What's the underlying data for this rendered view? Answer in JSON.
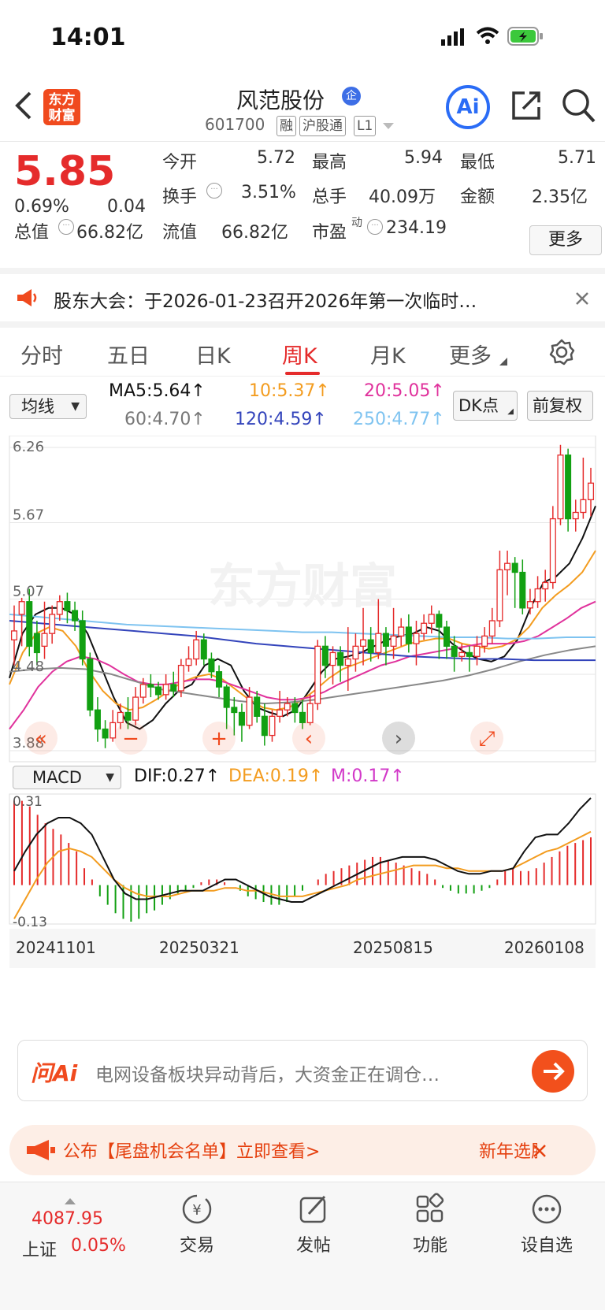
{
  "status": {
    "time": "14:01"
  },
  "header": {
    "logo_text": "东方财富",
    "title": "风范股份",
    "code": "601700",
    "tags": [
      "融",
      "沪股通",
      "L1"
    ],
    "ai_label": "Ai"
  },
  "quote": {
    "price": "5.85",
    "change_pct": "0.69%",
    "change": "0.04",
    "open_label": "今开",
    "open": "5.72",
    "high_label": "最高",
    "high": "5.94",
    "low_label": "最低",
    "low": "5.71",
    "turnover_label": "换手",
    "turnover": "3.51%",
    "volume_label": "总手",
    "volume": "40.09万",
    "amount_label": "金额",
    "amount": "2.35亿",
    "mcap_label": "总值",
    "mcap": "66.82亿",
    "float_label": "流值",
    "float": "66.82亿",
    "pe_label": "市盈",
    "pe_sup": "动",
    "pe": "234.19",
    "more": "更多"
  },
  "notice": {
    "text": "股东大会：于2026-01-23召开2026年第一次临时…"
  },
  "tabs": [
    "分时",
    "五日",
    "日K",
    "周K",
    "月K",
    "更多"
  ],
  "active_tab": "周K",
  "ma": {
    "selector": "均线",
    "ma5": "MA5:5.64↑",
    "ma10": "10:5.37↑",
    "ma20": "20:5.05↑",
    "ma60": "60:4.70↑",
    "ma120": "120:4.59↑",
    "ma250": "250:4.77↑",
    "dk": "DK点",
    "fq": "前复权",
    "colors": {
      "ma5": "#111111",
      "ma10": "#f39c1f",
      "ma20": "#e0329c",
      "ma60": "#888888",
      "ma120": "#3344bb",
      "ma250": "#7ec3f0"
    }
  },
  "macd": {
    "selector": "MACD",
    "dif": "DIF:0.27↑",
    "dea": "DEA:0.19↑",
    "m": "M:0.17↑",
    "ytop": "0.31",
    "ybot": "-0.13"
  },
  "chart_data": {
    "type": "candlestick",
    "y_ticks": [
      "6.26",
      "5.67",
      "5.07",
      "4.48",
      "3.88"
    ],
    "ylim": [
      3.88,
      6.26
    ],
    "x_labels": [
      "20241101",
      "20250321",
      "20250815",
      "20260108"
    ],
    "watermark": "东方财富",
    "candles": [
      [
        4.75,
        4.82,
        4.55,
        5.02
      ],
      [
        4.95,
        5.05,
        4.7,
        5.08
      ],
      [
        5.05,
        4.7,
        4.62,
        5.15
      ],
      [
        4.8,
        4.65,
        4.55,
        4.9
      ],
      [
        4.7,
        4.8,
        4.6,
        5.05
      ],
      [
        4.8,
        4.95,
        4.72,
        5.02
      ],
      [
        4.95,
        5.05,
        4.9,
        5.1
      ],
      [
        5.05,
        4.98,
        4.88,
        5.12
      ],
      [
        4.98,
        4.9,
        4.82,
        5.05
      ],
      [
        4.9,
        4.6,
        4.55,
        4.98
      ],
      [
        4.6,
        4.2,
        4.15,
        4.65
      ],
      [
        4.2,
        4.05,
        3.95,
        4.3
      ],
      [
        4.05,
        3.98,
        3.9,
        4.12
      ],
      [
        3.98,
        4.1,
        3.95,
        4.2
      ],
      [
        4.1,
        4.18,
        4.05,
        4.25
      ],
      [
        4.18,
        4.12,
        4.05,
        4.3
      ],
      [
        4.12,
        4.3,
        4.08,
        4.38
      ],
      [
        4.3,
        4.4,
        4.25,
        4.45
      ],
      [
        4.4,
        4.38,
        4.3,
        4.48
      ],
      [
        4.38,
        4.32,
        4.28,
        4.42
      ],
      [
        4.32,
        4.4,
        4.28,
        4.48
      ],
      [
        4.4,
        4.35,
        4.3,
        4.5
      ],
      [
        4.35,
        4.55,
        4.3,
        4.6
      ],
      [
        4.55,
        4.6,
        4.5,
        4.7
      ],
      [
        4.6,
        4.75,
        4.55,
        4.82
      ],
      [
        4.75,
        4.6,
        4.55,
        4.8
      ],
      [
        4.6,
        4.5,
        4.45,
        4.65
      ],
      [
        4.5,
        4.38,
        4.3,
        4.55
      ],
      [
        4.38,
        4.22,
        4.05,
        4.4
      ],
      [
        4.22,
        4.18,
        4.0,
        4.3
      ],
      [
        4.18,
        4.08,
        3.95,
        4.25
      ],
      [
        4.08,
        4.3,
        4.05,
        4.38
      ],
      [
        4.3,
        4.15,
        4.1,
        4.35
      ],
      [
        4.15,
        4.0,
        3.92,
        4.25
      ],
      [
        4.0,
        4.15,
        3.95,
        4.2
      ],
      [
        4.15,
        4.2,
        4.1,
        4.35
      ],
      [
        4.2,
        4.25,
        4.15,
        4.3
      ],
      [
        4.25,
        4.18,
        4.1,
        4.3
      ],
      [
        4.18,
        4.1,
        4.05,
        4.28
      ],
      [
        4.1,
        4.25,
        4.08,
        4.32
      ],
      [
        4.25,
        4.7,
        4.2,
        4.75
      ],
      [
        4.7,
        4.55,
        4.45,
        4.78
      ],
      [
        4.55,
        4.65,
        4.4,
        4.7
      ],
      [
        4.65,
        4.55,
        4.42,
        4.7
      ],
      [
        4.55,
        4.6,
        4.35,
        4.85
      ],
      [
        4.6,
        4.7,
        4.5,
        4.8
      ],
      [
        4.7,
        4.75,
        4.55,
        5.0
      ],
      [
        4.75,
        4.65,
        4.58,
        4.85
      ],
      [
        4.65,
        4.8,
        4.6,
        5.07
      ],
      [
        4.8,
        4.7,
        4.55,
        4.85
      ],
      [
        4.7,
        4.78,
        4.6,
        5.0
      ],
      [
        4.78,
        4.85,
        4.7,
        4.92
      ],
      [
        4.85,
        4.72,
        4.65,
        4.95
      ],
      [
        4.72,
        4.8,
        4.55,
        4.9
      ],
      [
        4.8,
        4.88,
        4.75,
        4.95
      ],
      [
        4.88,
        4.95,
        4.8,
        5.02
      ],
      [
        4.95,
        4.85,
        4.6,
        4.98
      ],
      [
        4.85,
        4.7,
        4.6,
        4.9
      ],
      [
        4.7,
        4.62,
        4.5,
        4.78
      ],
      [
        4.62,
        4.65,
        4.58,
        4.72
      ],
      [
        4.65,
        4.62,
        4.5,
        4.7
      ],
      [
        4.62,
        4.7,
        4.55,
        4.78
      ],
      [
        4.7,
        4.78,
        4.65,
        4.85
      ],
      [
        4.78,
        4.9,
        4.72,
        5.0
      ],
      [
        4.9,
        5.3,
        4.85,
        5.45
      ],
      [
        5.3,
        5.35,
        5.1,
        5.45
      ],
      [
        5.35,
        5.28,
        5.0,
        5.4
      ],
      [
        5.28,
        5.0,
        4.95,
        5.38
      ],
      [
        5.0,
        5.05,
        4.95,
        5.15
      ],
      [
        5.05,
        5.15,
        5.0,
        5.25
      ],
      [
        5.15,
        5.2,
        5.05,
        5.3
      ],
      [
        5.2,
        5.7,
        5.15,
        5.8
      ],
      [
        5.7,
        6.2,
        5.65,
        6.28
      ],
      [
        6.2,
        5.7,
        5.6,
        6.25
      ],
      [
        5.7,
        5.75,
        5.6,
        5.85
      ],
      [
        5.75,
        5.85,
        5.7,
        6.18
      ],
      [
        5.85,
        5.98,
        5.72,
        6.1
      ]
    ],
    "ma_series_values": {
      "ma5": [
        4.45,
        4.8,
        4.95,
        5.0,
        5.0,
        4.95,
        4.8,
        4.55,
        4.3,
        4.1,
        4.05,
        4.12,
        4.25,
        4.35,
        4.4,
        4.55,
        4.6,
        4.55,
        4.35,
        4.22,
        4.18,
        4.15,
        4.2,
        4.35,
        4.5,
        4.6,
        4.62,
        4.65,
        4.7,
        4.75,
        4.78,
        4.8,
        4.85,
        4.82,
        4.72,
        4.65,
        4.6,
        4.58,
        4.62,
        4.75,
        5.0,
        5.2,
        5.25,
        5.35,
        5.55,
        5.8
      ],
      "ma10": [
        4.4,
        4.65,
        4.8,
        4.85,
        4.82,
        4.7,
        4.5,
        4.35,
        4.25,
        4.2,
        4.22,
        4.28,
        4.35,
        4.42,
        4.46,
        4.48,
        4.44,
        4.36,
        4.28,
        4.22,
        4.2,
        4.22,
        4.28,
        4.36,
        4.45,
        4.52,
        4.56,
        4.6,
        4.64,
        4.68,
        4.72,
        4.74,
        4.76,
        4.76,
        4.72,
        4.7,
        4.68,
        4.7,
        4.75,
        4.85,
        5.0,
        5.1,
        5.18,
        5.28,
        5.45
      ],
      "ma20": [
        4.05,
        4.2,
        4.38,
        4.5,
        4.58,
        4.62,
        4.6,
        4.55,
        4.48,
        4.42,
        4.4,
        4.4,
        4.42,
        4.44,
        4.44,
        4.42,
        4.38,
        4.34,
        4.3,
        4.28,
        4.28,
        4.3,
        4.34,
        4.4,
        4.45,
        4.5,
        4.55,
        4.58,
        4.62,
        4.64,
        4.66,
        4.68,
        4.7,
        4.72,
        4.72,
        4.72,
        4.74,
        4.78,
        4.85,
        4.92,
        5.0,
        5.05
      ],
      "ma60": [
        4.5,
        4.52,
        4.53,
        4.52,
        4.48,
        4.42,
        4.36,
        4.33,
        4.3,
        4.27,
        4.25,
        4.26,
        4.28,
        4.31,
        4.34,
        4.37,
        4.4,
        4.43,
        4.47,
        4.52,
        4.58,
        4.63,
        4.67,
        4.7
      ],
      "ma120": [
        4.9,
        4.88,
        4.86,
        4.84,
        4.82,
        4.8,
        4.78,
        4.75,
        4.72,
        4.7,
        4.68,
        4.66,
        4.64,
        4.62,
        4.61,
        4.6,
        4.6,
        4.59,
        4.59,
        4.59
      ],
      "ma250": [
        4.95,
        4.93,
        4.91,
        4.89,
        4.87,
        4.86,
        4.85,
        4.84,
        4.83,
        4.82,
        4.81,
        4.81,
        4.8,
        4.79,
        4.78,
        4.77,
        4.77,
        4.76,
        4.76,
        4.77,
        4.77
      ]
    },
    "macd_hist": [
      0.3,
      0.3,
      0.28,
      0.25,
      0.22,
      0.2,
      0.18,
      0.15,
      0.12,
      0.06,
      0.02,
      -0.04,
      -0.07,
      -0.1,
      -0.12,
      -0.13,
      -0.12,
      -0.1,
      -0.09,
      -0.07,
      -0.05,
      -0.03,
      -0.02,
      -0.01,
      0.01,
      0.02,
      0.02,
      0.01,
      0.0,
      -0.02,
      -0.04,
      -0.05,
      -0.06,
      -0.07,
      -0.07,
      -0.06,
      -0.04,
      -0.02,
      0.0,
      0.02,
      0.04,
      0.05,
      0.06,
      0.07,
      0.08,
      0.09,
      0.1,
      0.1,
      0.09,
      0.08,
      0.07,
      0.06,
      0.05,
      0.04,
      0.02,
      -0.01,
      -0.02,
      -0.03,
      -0.03,
      -0.03,
      -0.02,
      -0.01,
      0.02,
      0.05,
      0.06,
      0.05,
      0.05,
      0.06,
      0.08,
      0.1,
      0.12,
      0.14,
      0.15,
      0.16,
      0.17
    ],
    "dif": [
      0.05,
      0.12,
      0.18,
      0.22,
      0.24,
      0.24,
      0.22,
      0.18,
      0.1,
      0.02,
      -0.03,
      -0.05,
      -0.05,
      -0.04,
      -0.03,
      -0.02,
      -0.02,
      -0.02,
      0.0,
      0.02,
      0.02,
      0.0,
      -0.02,
      -0.04,
      -0.05,
      -0.06,
      -0.06,
      -0.04,
      -0.02,
      0.0,
      0.02,
      0.04,
      0.06,
      0.08,
      0.09,
      0.1,
      0.1,
      0.1,
      0.09,
      0.07,
      0.05,
      0.04,
      0.04,
      0.05,
      0.05,
      0.06,
      0.12,
      0.17,
      0.18,
      0.18,
      0.22,
      0.27,
      0.31
    ],
    "dea": [
      -0.12,
      -0.05,
      0.02,
      0.08,
      0.12,
      0.13,
      0.12,
      0.1,
      0.06,
      0.02,
      -0.01,
      -0.03,
      -0.04,
      -0.04,
      -0.04,
      -0.03,
      -0.02,
      -0.02,
      -0.02,
      -0.01,
      -0.01,
      -0.02,
      -0.02,
      -0.03,
      -0.04,
      -0.04,
      -0.04,
      -0.03,
      -0.02,
      -0.01,
      0.0,
      0.02,
      0.03,
      0.04,
      0.05,
      0.06,
      0.07,
      0.07,
      0.07,
      0.06,
      0.06,
      0.05,
      0.05,
      0.05,
      0.05,
      0.06,
      0.08,
      0.1,
      0.12,
      0.13,
      0.15,
      0.17,
      0.19
    ]
  },
  "ai_bar": {
    "logo": "问Ai",
    "text": "电网设备板块异动背后，大资金正在调仓…"
  },
  "promo": {
    "text": "公布【尾盘机会名单】立即查看>",
    "right": "新年选股"
  },
  "bottom": {
    "index_value": "4087.95",
    "index_name": "上证",
    "index_change": "0.05%",
    "items": [
      "交易",
      "发帖",
      "功能",
      "设自选"
    ]
  }
}
